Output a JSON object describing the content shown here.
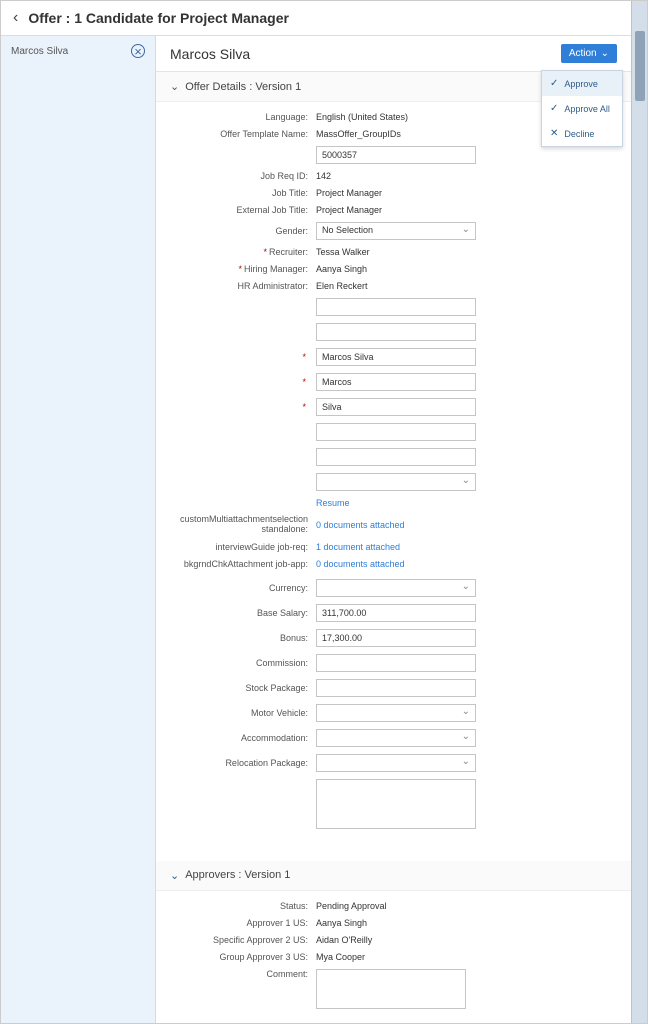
{
  "header": {
    "title": "Offer : 1 Candidate for Project Manager"
  },
  "sidebar": {
    "candidate_name": "Marcos Silva"
  },
  "candidate": {
    "name": "Marcos Silva"
  },
  "action_button": {
    "label": "Action"
  },
  "action_menu": {
    "approve": "Approve",
    "approve_all": "Approve All",
    "decline": "Decline"
  },
  "sections": {
    "offer_details_title": "Offer Details : Version 1",
    "approvers_title": "Approvers : Version 1"
  },
  "offer": {
    "labels": {
      "language": "Language:",
      "offer_template_name": "Offer Template Name:",
      "job_req_id": "Job Req ID:",
      "job_title": "Job Title:",
      "external_job_title": "External Job Title:",
      "gender": "Gender:",
      "recruiter": "Recruiter:",
      "hiring_manager": "Hiring Manager:",
      "hr_administrator": "HR Administrator:",
      "resume": "Resume",
      "custom_multi": "customMultiattachmentselection standalone:",
      "interview_guide": "interviewGuide job-req:",
      "bkgrnd_chk": "bkgrndChkAttachment job-app:",
      "currency": "Currency:",
      "base_salary": "Base Salary:",
      "bonus": "Bonus:",
      "commission": "Commission:",
      "stock_package": "Stock Package:",
      "motor_vehicle": "Motor Vehicle:",
      "accommodation": "Accommodation:",
      "relocation_package": "Relocation Package:"
    },
    "values": {
      "language": "English (United States)",
      "offer_template_name": "MassOffer_GroupIDs",
      "template_id": "5000357",
      "job_req_id": "142",
      "job_title": "Project Manager",
      "external_job_title": "Project Manager",
      "gender": "No Selection",
      "recruiter": "Tessa Walker",
      "hiring_manager": "Aanya Singh",
      "hr_administrator": "Elen Reckert",
      "full_name": "Marcos Silva",
      "first_name": "Marcos",
      "last_name": "Silva",
      "custom_multi": "0 documents attached",
      "interview_guide": "1 document attached",
      "bkgrnd_chk": "0 documents attached",
      "base_salary": "311,700.00",
      "bonus": "17,300.00"
    }
  },
  "approvers": {
    "labels": {
      "status": "Status:",
      "approver1": "Approver 1 US:",
      "specific_approver2": "Specific Approver 2 US:",
      "group_approver3": "Group Approver 3 US:",
      "comment": "Comment:"
    },
    "values": {
      "status": "Pending Approval",
      "approver1": "Aanya Singh",
      "specific_approver2": "Aidan O'Reilly",
      "group_approver3": "Mya Cooper"
    }
  }
}
